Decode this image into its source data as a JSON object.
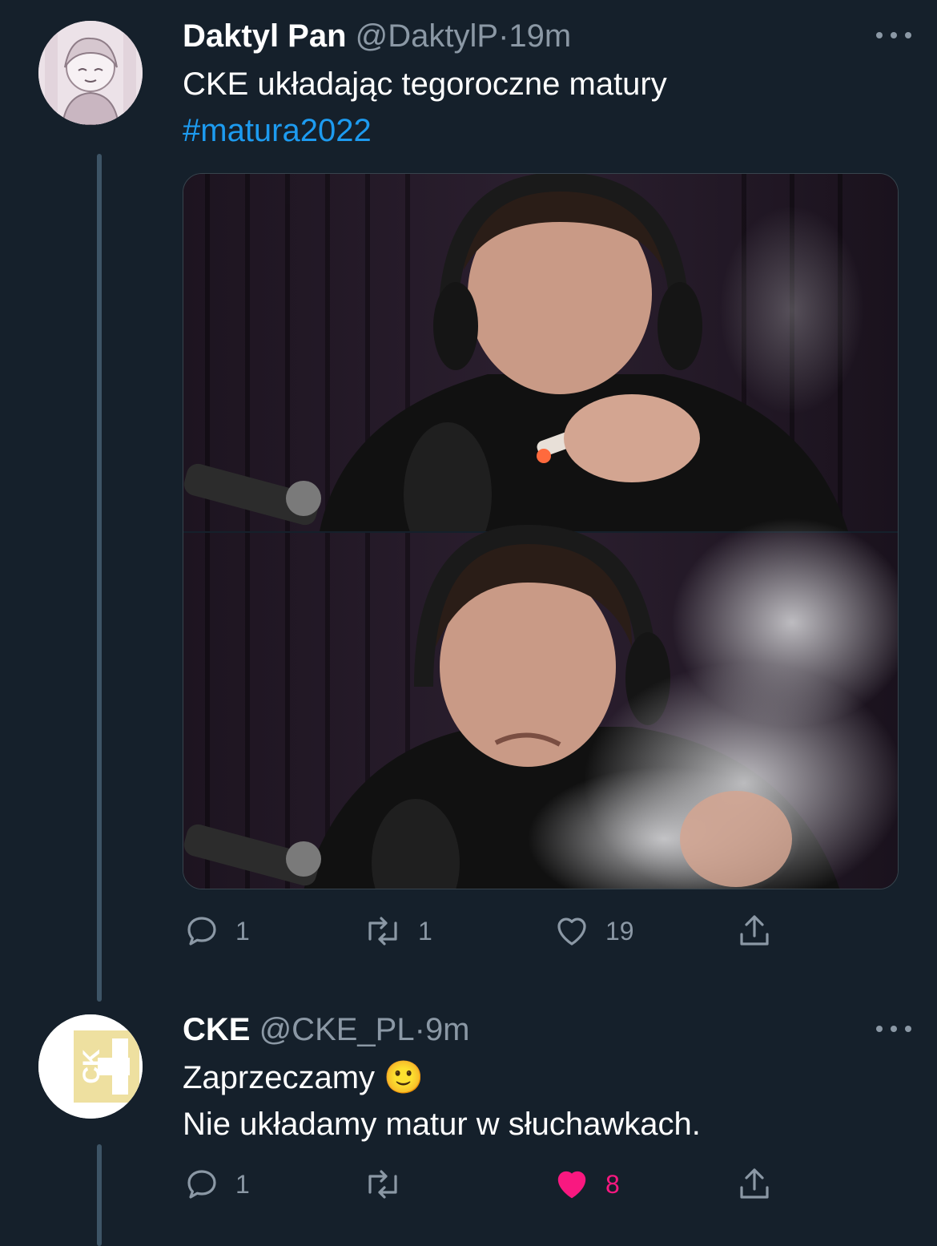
{
  "tweets": [
    {
      "name": "Daktyl Pan",
      "handle": "@DaktylP",
      "separator": "·",
      "time": "19m",
      "text_line1": "CKE układając tegoroczne matury",
      "hashtag": "#matura2022",
      "stats": {
        "replies": "1",
        "retweets": "1",
        "likes": "19"
      }
    },
    {
      "name": "CKE",
      "handle": "@CKE_PL",
      "separator": "·",
      "time": "9m",
      "text_line1": "Zaprzeczamy 🙂",
      "text_line2": "Nie układamy matur w słuchawkach.",
      "avatar_text": "CK",
      "stats": {
        "replies": "1",
        "retweets": "",
        "likes": "8"
      }
    }
  ],
  "colors": {
    "background": "#15202b",
    "secondary_text": "#8b98a5",
    "link": "#1d9bf0",
    "like": "#f91880",
    "cke_avatar": "#eee0a0"
  },
  "icons": [
    "more-icon",
    "reply-icon",
    "retweet-icon",
    "like-icon",
    "share-icon"
  ]
}
